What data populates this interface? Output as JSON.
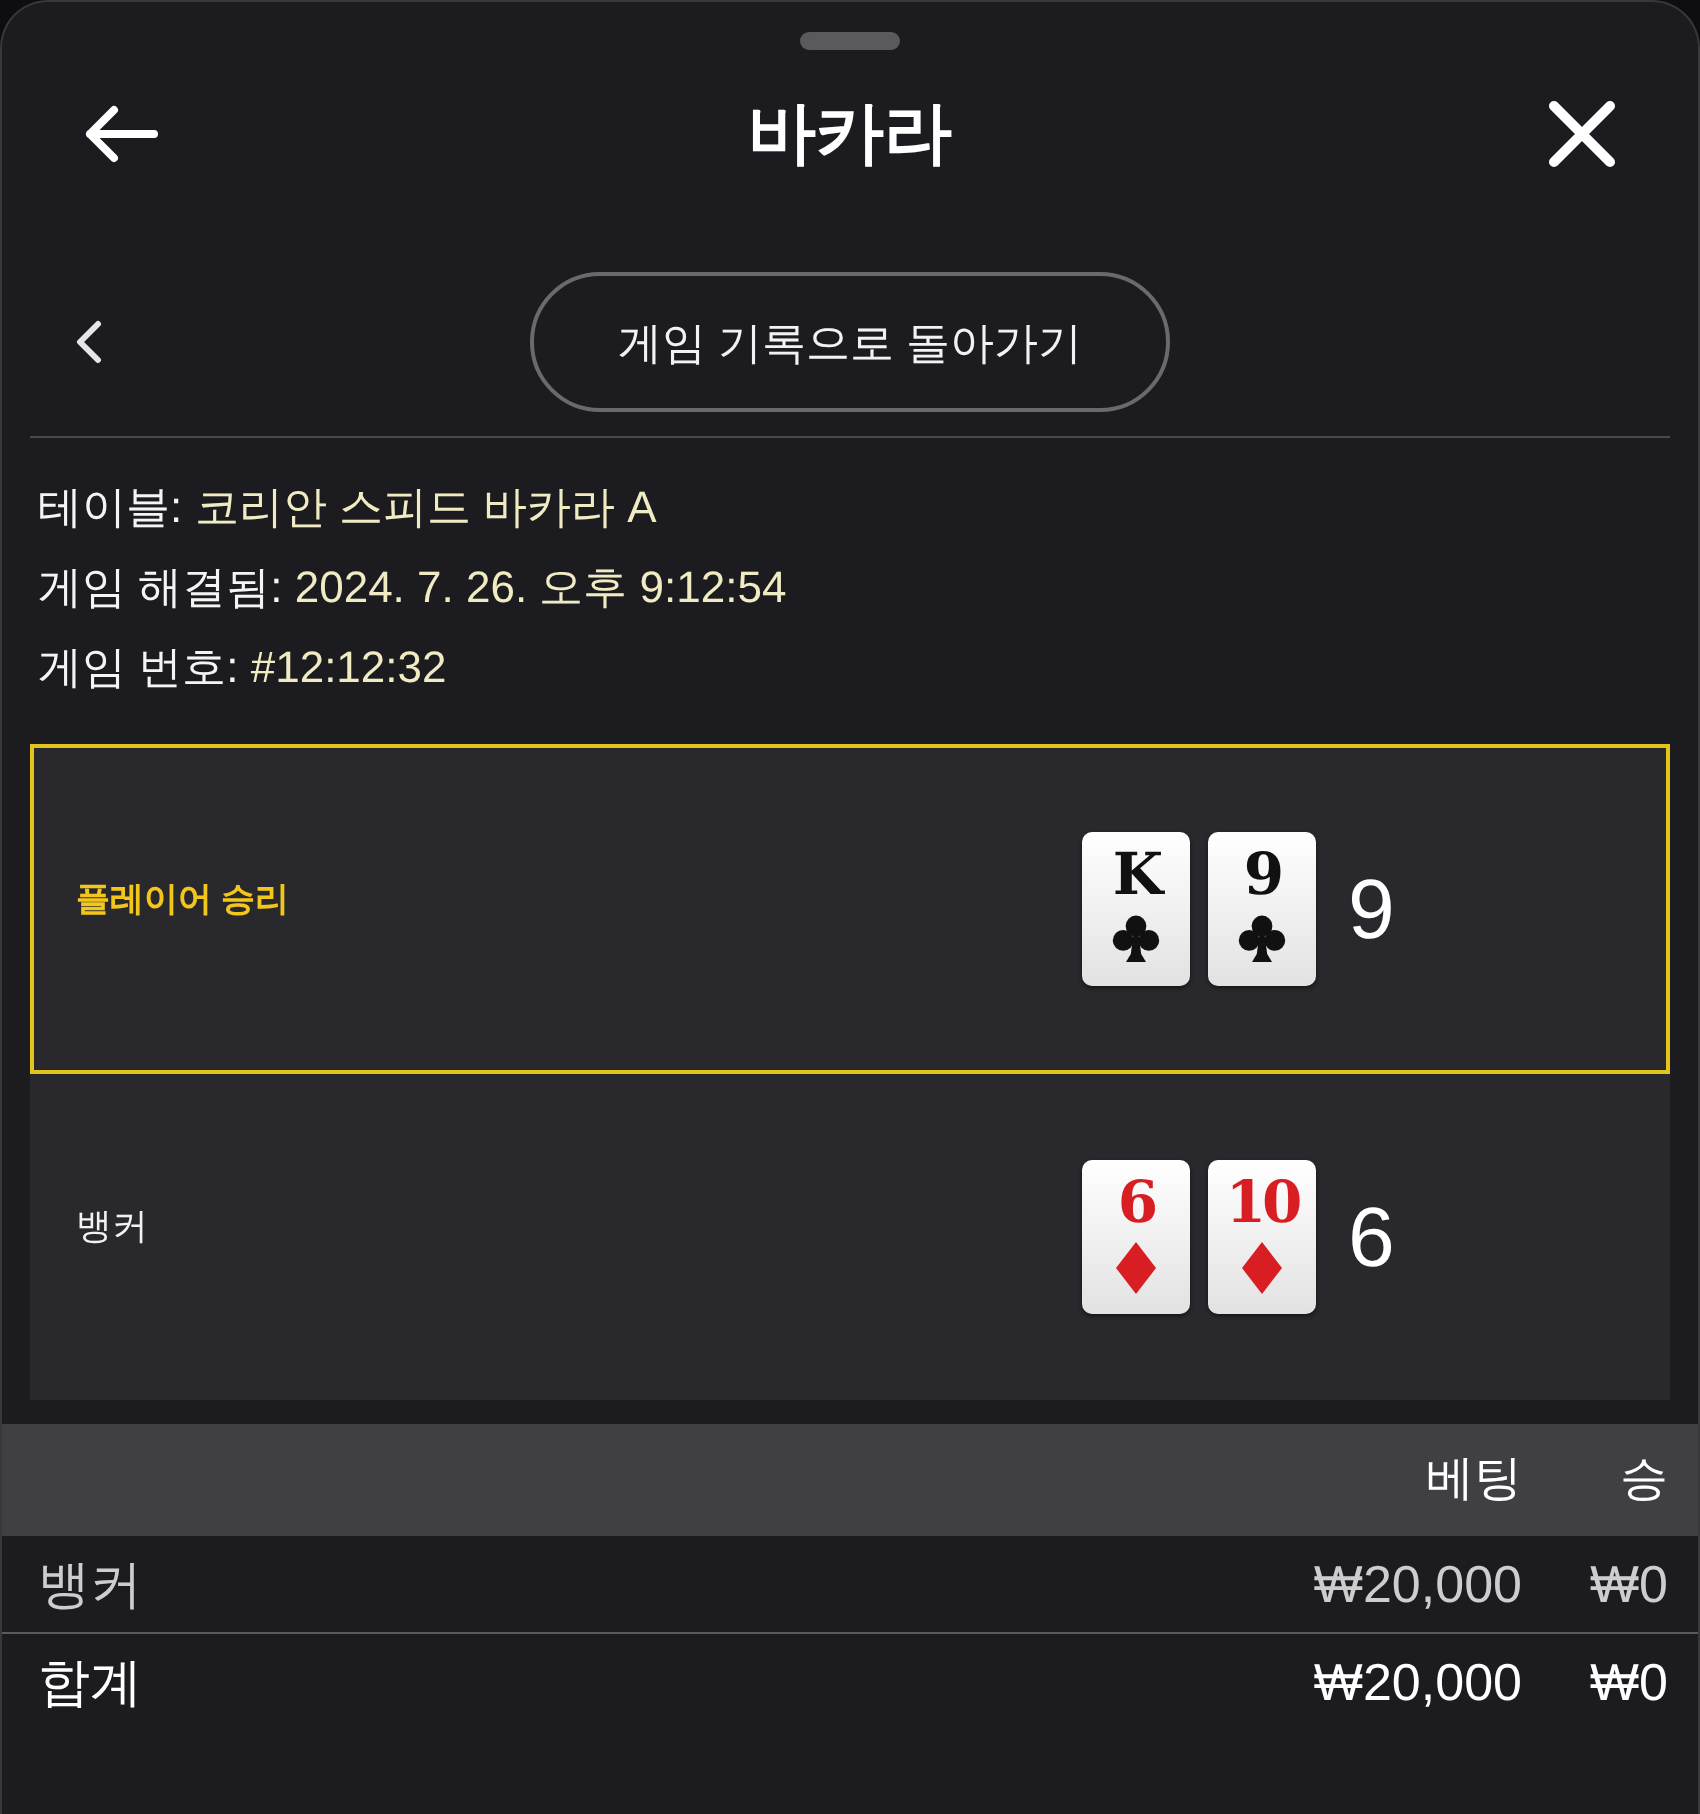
{
  "sheet": {
    "title": "바카라"
  },
  "back_link": {
    "label": "게임 기록으로 돌아가기"
  },
  "details": [
    {
      "label": "테이블:",
      "value": "코리안 스피드 바카라 A"
    },
    {
      "label": "게임 해결됨:",
      "value": "2024. 7. 26. 오후 9:12:54"
    },
    {
      "label": "게임 번호:",
      "value": "#12:12:32"
    }
  ],
  "hands": [
    {
      "label": "플레이어 승리",
      "winner": true,
      "cards": [
        {
          "rank": "K",
          "kind": "clubs"
        },
        {
          "rank": "9",
          "kind": "clubs"
        }
      ],
      "score": "9"
    },
    {
      "label": "뱅커",
      "winner": false,
      "cards": [
        {
          "rank": "6",
          "kind": "diamonds"
        },
        {
          "rank": "10",
          "kind": "diamonds"
        }
      ],
      "score": "6"
    }
  ],
  "bets_table": {
    "columns": [
      "베팅",
      "승"
    ],
    "rows": [
      {
        "kind": "bet",
        "label": "뱅커",
        "bet": "₩20,000",
        "win": "₩0"
      },
      {
        "kind": "total",
        "label": "합계",
        "bet": "₩20,000",
        "win": "₩0"
      }
    ]
  }
}
